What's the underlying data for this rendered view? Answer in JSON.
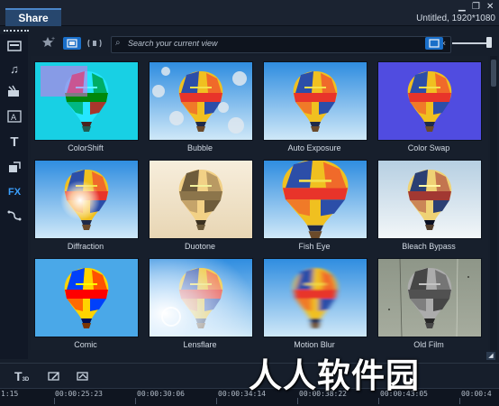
{
  "titlebar": {
    "tab_label": "Share",
    "project_info": "Untitled, 1920*1080",
    "minimize": "▁",
    "restore": "❐",
    "close": "✕"
  },
  "toolbar": {
    "search_placeholder": "Search your current view",
    "clear": "×"
  },
  "sidebar": {
    "fx_label": "FX"
  },
  "filters": [
    {
      "label": "ColorShift"
    },
    {
      "label": "Bubble"
    },
    {
      "label": "Auto Exposure"
    },
    {
      "label": "Color Swap"
    },
    {
      "label": "Diffraction"
    },
    {
      "label": "Duotone"
    },
    {
      "label": "Fish Eye"
    },
    {
      "label": "Bleach Bypass"
    },
    {
      "label": "Comic"
    },
    {
      "label": "Lensflare"
    },
    {
      "label": "Motion Blur"
    },
    {
      "label": "Old Film"
    }
  ],
  "timeline": {
    "title_icon_label": "T",
    "title_icon_sub": "3D",
    "timecodes": [
      "1:15",
      "00:00:25:23",
      "00:00:30:06",
      "00:00:34:14",
      "00:00:38:22",
      "00:00:43:05",
      "00:00:4"
    ]
  },
  "watermark": {
    "text": "人人软件园"
  }
}
